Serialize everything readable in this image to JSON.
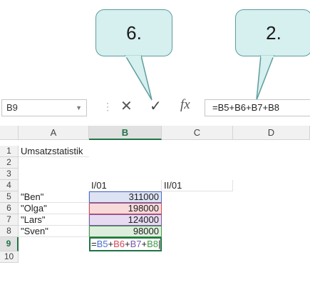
{
  "callouts": {
    "left": "6.",
    "right": "2."
  },
  "formula_bar": {
    "name_box": "B9",
    "name_box_dropdown_icon": "chevron-down-icon",
    "cancel_icon": "close-icon",
    "enter_icon": "check-icon",
    "function_icon": "fx-icon",
    "cancel_glyph": "✕",
    "enter_glyph": "✓",
    "fx_glyph": "fx",
    "formula": "=B5+B6+B7+B8"
  },
  "columns": [
    "A",
    "B",
    "C",
    "D"
  ],
  "selected_column": "B",
  "rows": [
    "1",
    "2",
    "3",
    "4",
    "5",
    "6",
    "7",
    "8",
    "9",
    "10"
  ],
  "selected_row": "9",
  "cells": {
    "A1": "Umsatzstatistik",
    "B4": "I/01",
    "C4": "II/01",
    "A5": "\"Ben\"",
    "B5": "311000",
    "A6": "\"Olga\"",
    "B6": "198000",
    "A7": "\"Lars\"",
    "B7": "124000",
    "A8": "\"Sven\"",
    "B8": "98000"
  },
  "editing_cell": {
    "prefix": "=",
    "refs": [
      "B5",
      "B6",
      "B7",
      "B8"
    ],
    "ops": [
      "+",
      "+",
      "+"
    ]
  },
  "ref_colors": {
    "B5": "#4a6fd0",
    "B6": "#d34a56",
    "B7": "#7c58a8",
    "B8": "#3f9b45"
  }
}
